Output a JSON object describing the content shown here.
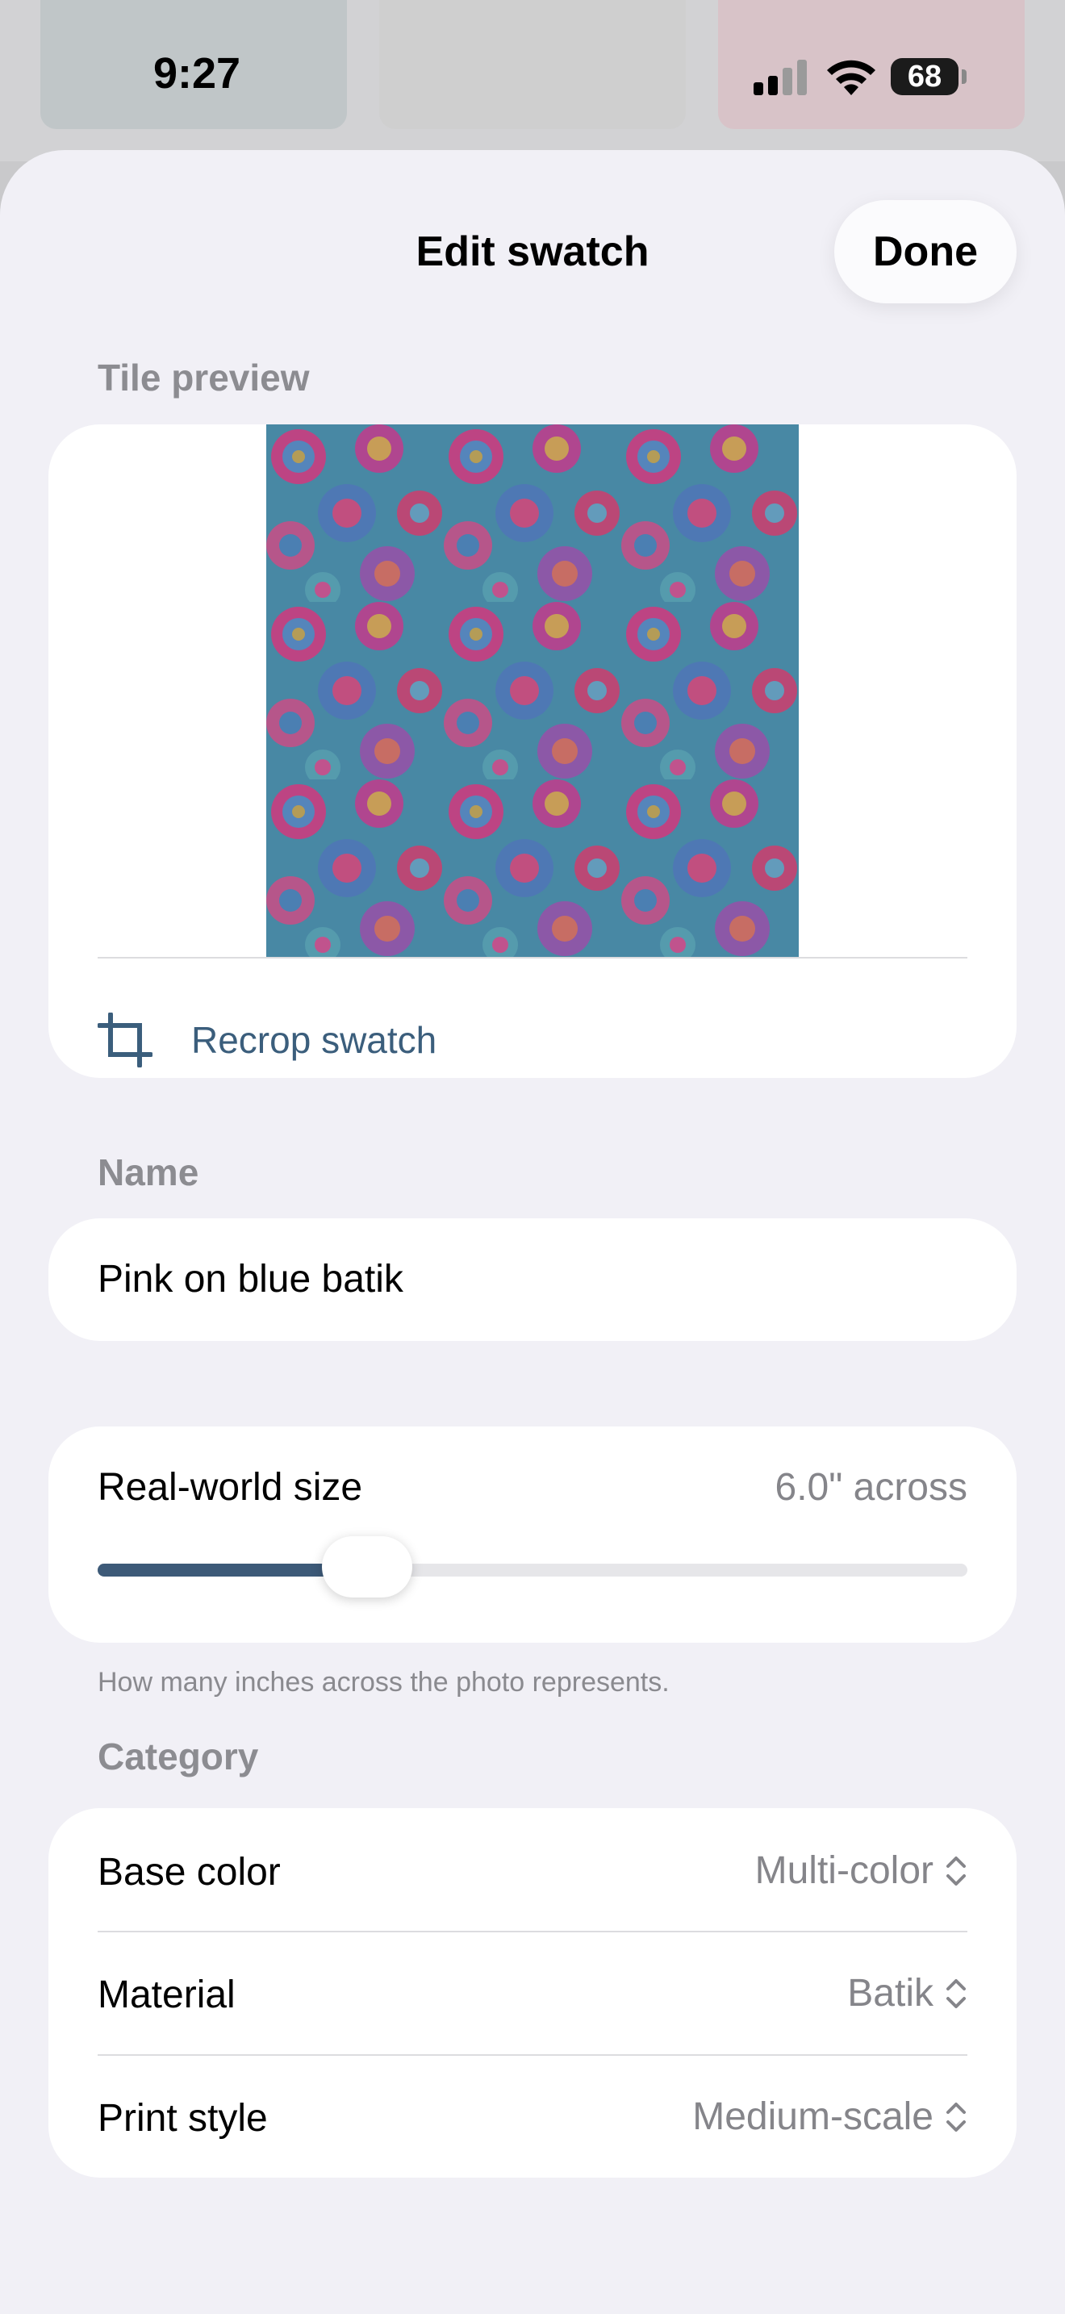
{
  "status_bar": {
    "time": "9:27",
    "battery": "68"
  },
  "header": {
    "title": "Edit swatch",
    "done_label": "Done"
  },
  "tile_preview": {
    "section_label": "Tile preview",
    "recrop_label": "Recrop swatch"
  },
  "name": {
    "section_label": "Name",
    "value": "Pink on blue batik"
  },
  "size": {
    "label": "Real-world size",
    "value_text": "6.0\" across",
    "slider_fraction": 0.31,
    "helper": "How many inches across the photo represents."
  },
  "category": {
    "section_label": "Category",
    "rows": [
      {
        "label": "Base color",
        "value": "Multi-color"
      },
      {
        "label": "Material",
        "value": "Batik"
      },
      {
        "label": "Print style",
        "value": "Medium-scale"
      }
    ]
  },
  "colors": {
    "accent": "#3d5a78",
    "sheet_bg": "#f1f0f6",
    "secondary_text": "#85858a"
  }
}
